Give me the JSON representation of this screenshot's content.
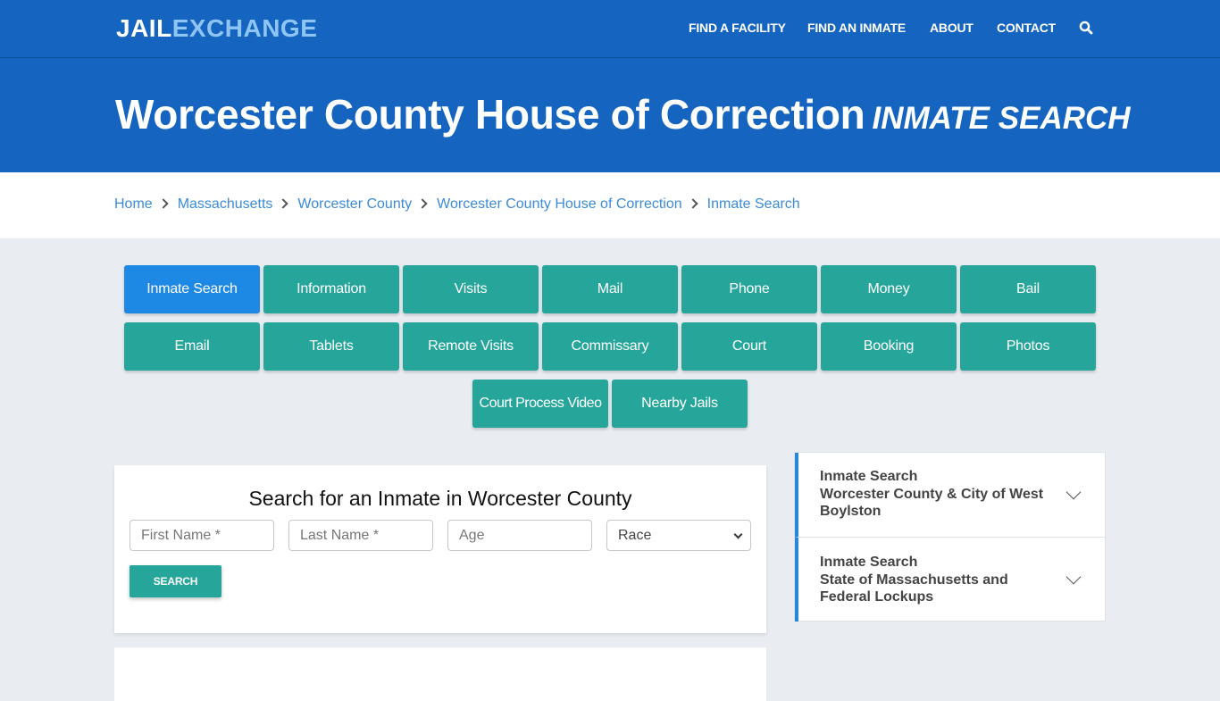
{
  "header": {
    "logo_part1": "JAIL",
    "logo_part2": "EXCHANGE",
    "nav": [
      "FIND A FACILITY",
      "FIND AN INMATE",
      "ABOUT",
      "CONTACT"
    ],
    "search_icon": "search-icon"
  },
  "hero": {
    "title": "Worcester County House of Correction",
    "subtitle": "INMATE SEARCH"
  },
  "breadcrumb": [
    "Home",
    "Massachusetts",
    "Worcester County",
    "Worcester County House of Correction",
    "Inmate Search"
  ],
  "tabs": {
    "active": "Inmate Search",
    "row1": [
      "Inmate Search",
      "Information",
      "Visits",
      "Mail",
      "Phone",
      "Money",
      "Bail"
    ],
    "row2": [
      "Email",
      "Tablets",
      "Remote Visits",
      "Commissary",
      "Court",
      "Booking",
      "Photos"
    ],
    "row3": [
      "Court Process Video",
      "Nearby Jails"
    ]
  },
  "search_form": {
    "title": "Search for an Inmate in Worcester County",
    "first_name_placeholder": "First Name *",
    "last_name_placeholder": "Last Name *",
    "age_placeholder": "Age",
    "race_selected": "Race",
    "submit_label": "SEARCH"
  },
  "sidebar": {
    "items": [
      {
        "line1": "Inmate Search",
        "line2": "Worcester County & City of West Boylston"
      },
      {
        "line1": "Inmate Search",
        "line2": "State of Massachusetts and Federal Lockups"
      }
    ]
  },
  "colors": {
    "header_blue": "#1565c0",
    "logo_accent": "#8ec5f5",
    "teal": "#26a69a",
    "active_blue": "#1e88e5",
    "link_blue": "#3b8bd9",
    "sidebar_accent": "#2a86d8",
    "page_bg": "#e9edf1"
  }
}
